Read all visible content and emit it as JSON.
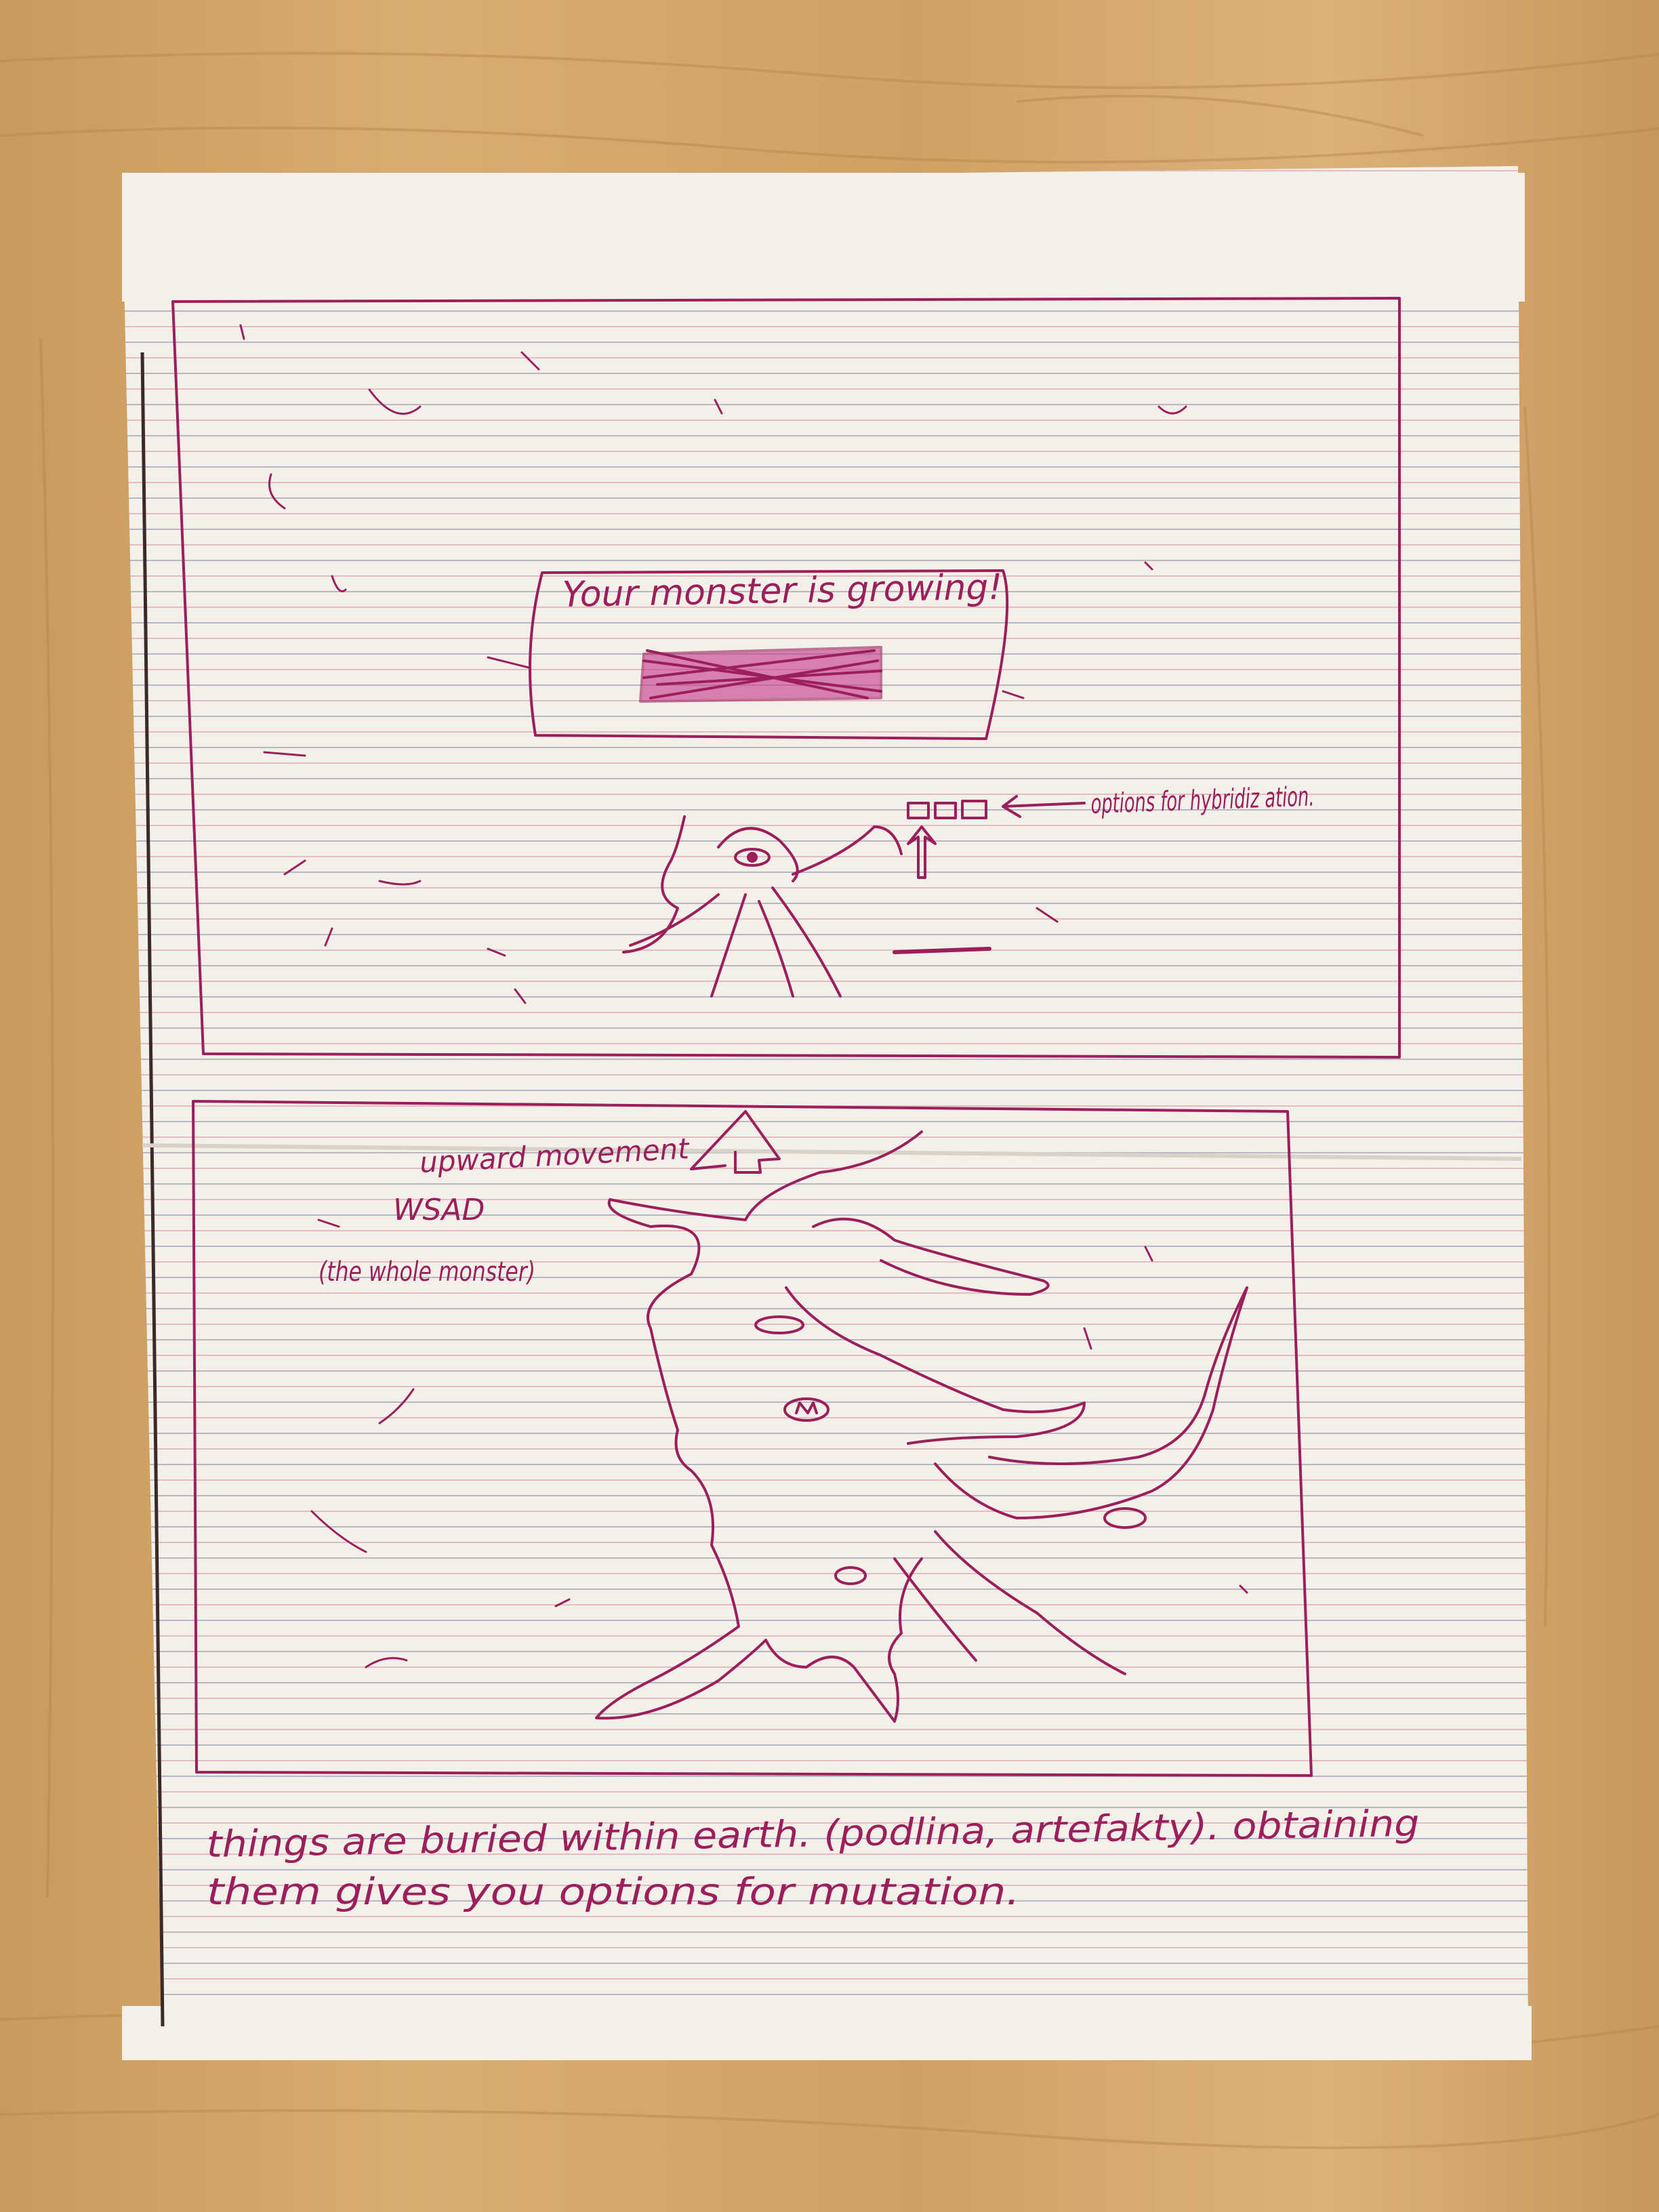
{
  "photo": {
    "subject": "hand-drawn game concept sketch on lined paper",
    "colors": {
      "ink": "#9c1f5c",
      "paper": "#f3f0ea",
      "table": "#d3a56a",
      "rule_blue": "#b6b9c4",
      "rule_red": "#e2aab2"
    }
  },
  "panel_top": {
    "dialog_text": "Your monster is growing!",
    "options_label": "options for hybridiz ation."
  },
  "panel_bottom": {
    "movement_label": "upward movement",
    "keys_label": "WSAD",
    "scope_label": "(the whole monster)"
  },
  "footer_note": {
    "line1": "things are buried within earth. (podlina, artefakty). obtaining",
    "line2": "them gives you options for mutation."
  }
}
